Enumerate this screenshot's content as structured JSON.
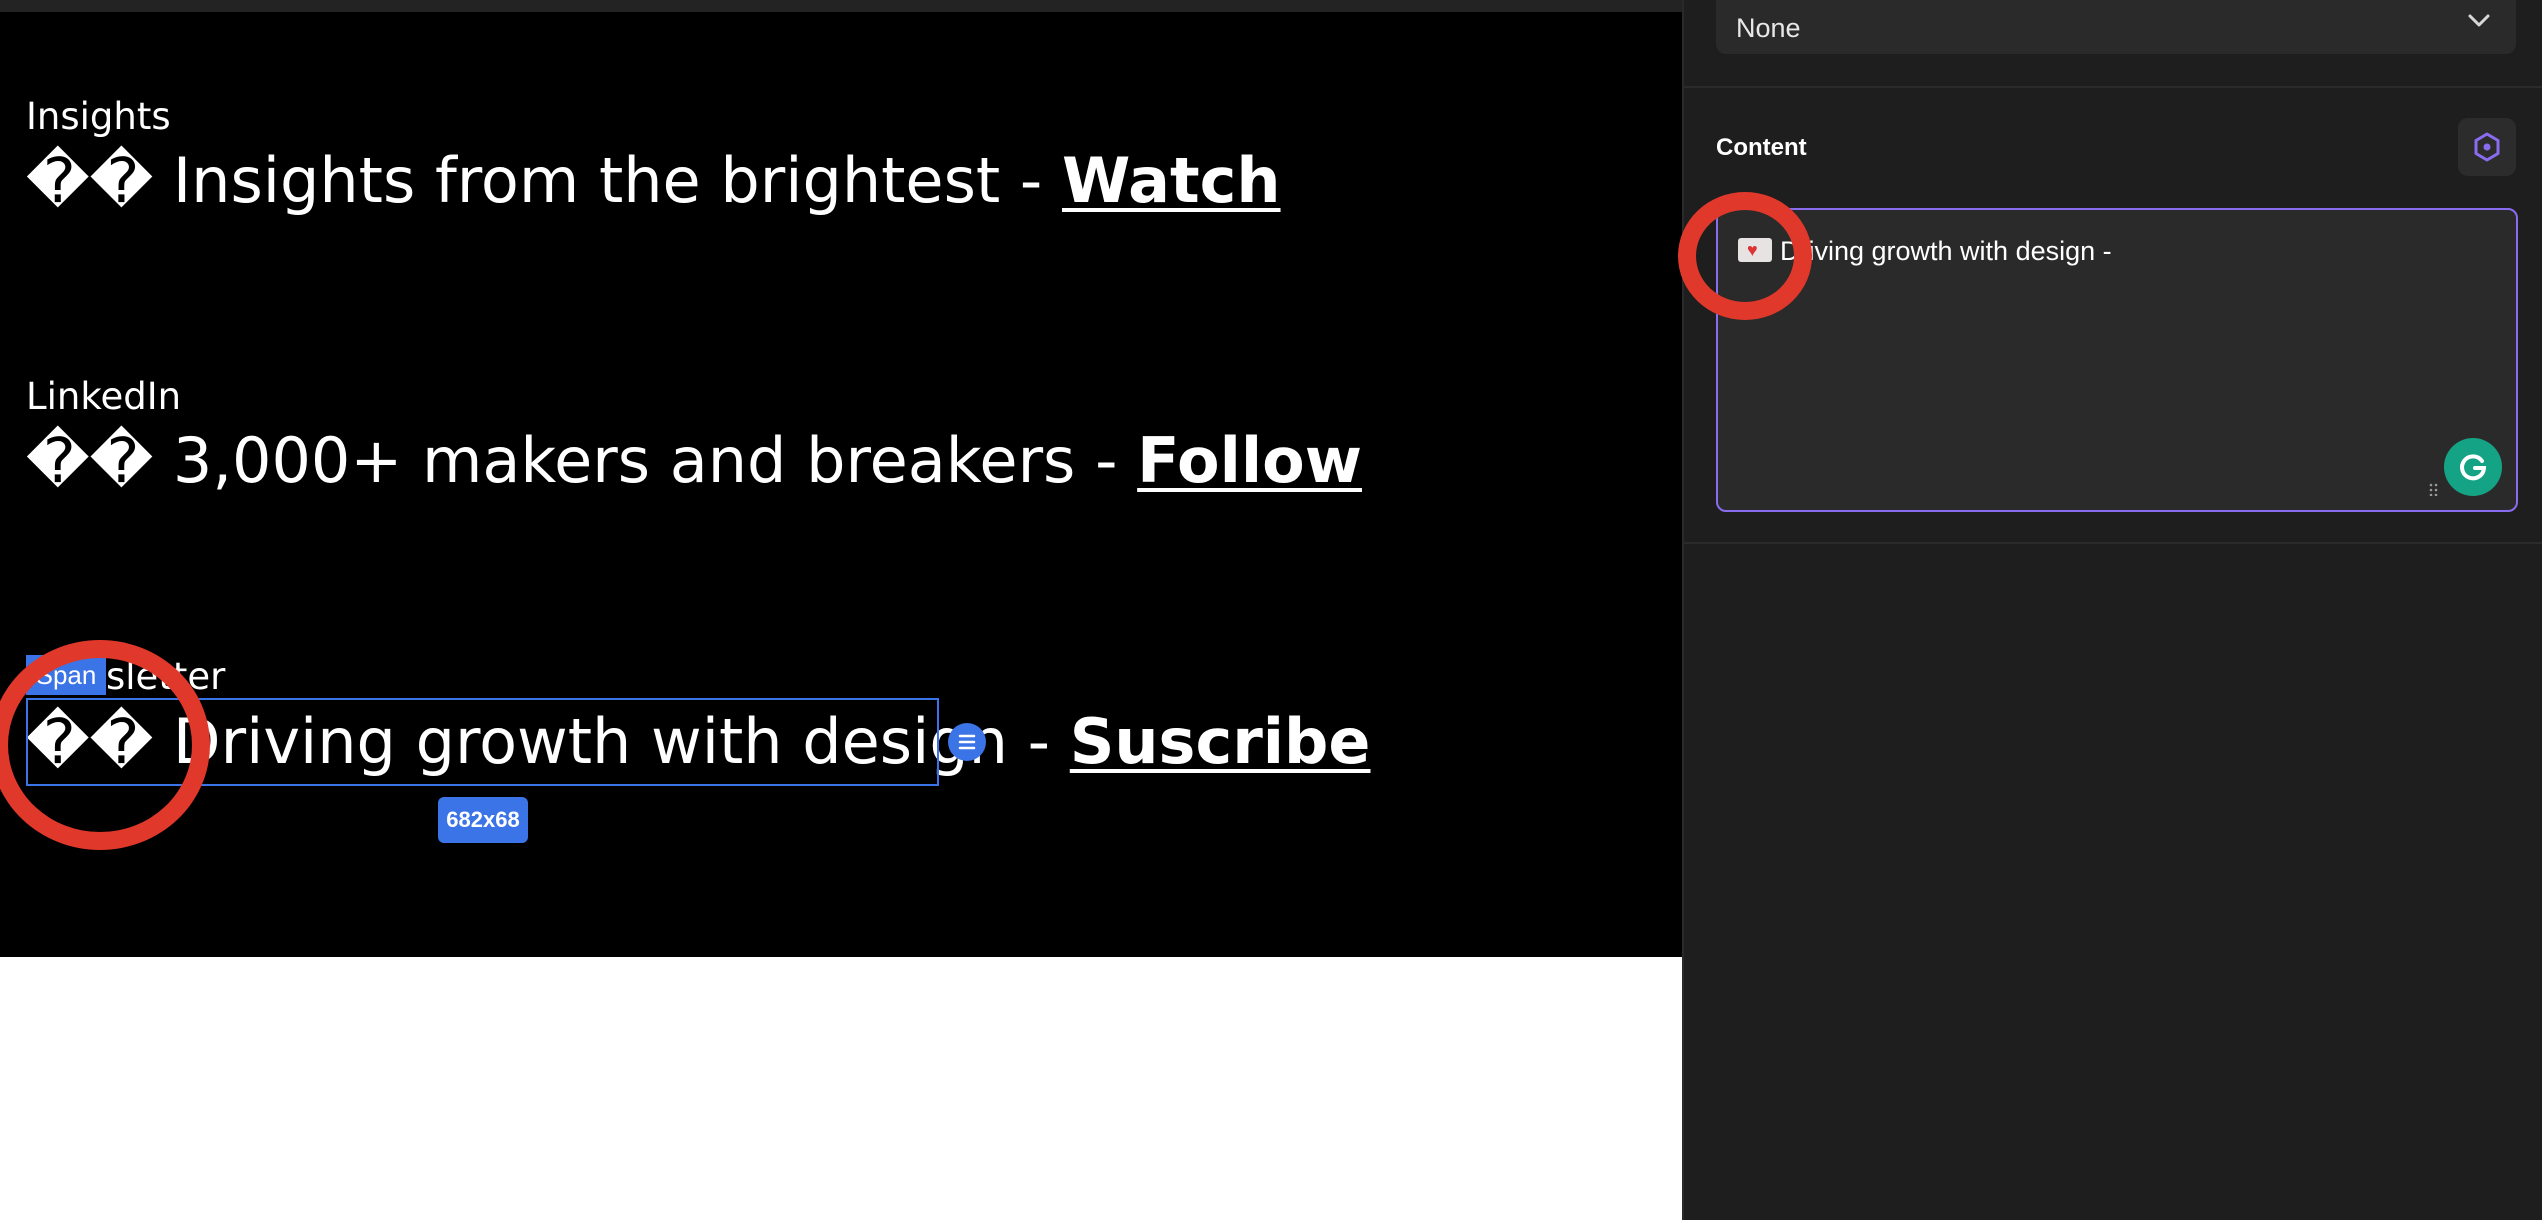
{
  "canvas": {
    "blocks": [
      {
        "eyebrow": "Insights",
        "glyph": "��",
        "text": "Insights from the brightest - ",
        "cta": "Watch"
      },
      {
        "eyebrow": "LinkedIn",
        "glyph": "��",
        "text": "3,000+ makers and breakers - ",
        "cta": "Follow"
      },
      {
        "eyebrow": "sletter",
        "glyph": "��",
        "text": "Driving growth with design - ",
        "cta": "Suscribe"
      }
    ],
    "selection": {
      "tag": "Span",
      "size": "682x68",
      "handle_icon": "align-icon"
    }
  },
  "panel": {
    "select": {
      "value": "None",
      "icon": "chevron-down-icon"
    },
    "content": {
      "label": "Content",
      "settings_icon": "hexagon-icon",
      "textarea": {
        "emoji": "love-letter-emoji",
        "value": "Driving growth with design -"
      },
      "grammarly_icon": "grammarly-icon"
    }
  },
  "annotations": {
    "circle_color": "#e0382b"
  },
  "colors": {
    "selection": "#3b74e6",
    "textarea_border": "#8a6cf0"
  }
}
